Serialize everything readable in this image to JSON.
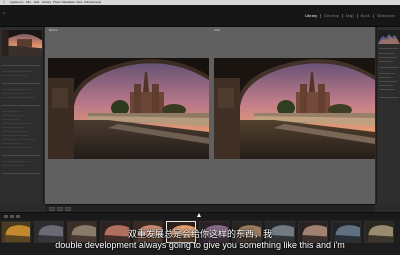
{
  "menu_bar": {
    "items": [
      "",
      "Lightroom",
      "File",
      "Edit",
      "Library",
      "Photo",
      "Metadata",
      "View",
      "Window",
      "Help"
    ]
  },
  "window": {
    "title": ""
  },
  "modules": [
    "Library",
    "Develop",
    "Map",
    "Book",
    "Slideshow"
  ],
  "active_module": "Library",
  "view": {
    "before_label": "Before",
    "after_label": "After"
  },
  "filmstrip": {
    "thumb_count": 12,
    "selected_index": 5
  },
  "subtitles": {
    "cn": "双重发展总是会给你这样的东西，我",
    "en": "double development always going to give you something like this and i'm"
  },
  "colors": {
    "accent": "#e6e6e6",
    "panel": "#2d2d2d",
    "canvas": "#606060"
  }
}
